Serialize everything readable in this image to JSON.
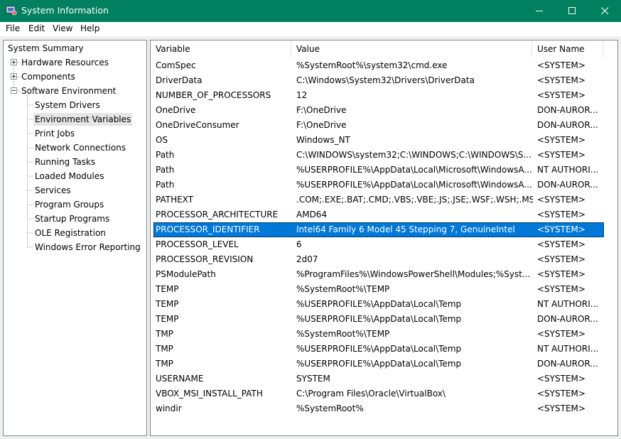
{
  "window": {
    "title": "System Information",
    "icon": "system-information-icon",
    "titlebar_color": "#00805f",
    "controls": [
      "minimize-icon",
      "maximize-icon",
      "close-icon"
    ]
  },
  "menu": [
    "File",
    "Edit",
    "View",
    "Help"
  ],
  "tree": [
    {
      "label": "System Summary",
      "level": 0,
      "expander": "none"
    },
    {
      "label": "Hardware Resources",
      "level": 1,
      "expander": "plus"
    },
    {
      "label": "Components",
      "level": 1,
      "expander": "plus"
    },
    {
      "label": "Software Environment",
      "level": 1,
      "expander": "minus"
    },
    {
      "label": "System Drivers",
      "level": 2
    },
    {
      "label": "Environment Variables",
      "level": 2,
      "selected": true
    },
    {
      "label": "Print Jobs",
      "level": 2
    },
    {
      "label": "Network Connections",
      "level": 2
    },
    {
      "label": "Running Tasks",
      "level": 2
    },
    {
      "label": "Loaded Modules",
      "level": 2
    },
    {
      "label": "Services",
      "level": 2
    },
    {
      "label": "Program Groups",
      "level": 2
    },
    {
      "label": "Startup Programs",
      "level": 2
    },
    {
      "label": "OLE Registration",
      "level": 2
    },
    {
      "label": "Windows Error Reporting",
      "level": 2
    }
  ],
  "table": {
    "columns": [
      "Variable",
      "Value",
      "User Name"
    ],
    "selection_color": "#0078d7",
    "rows": [
      [
        "ComSpec",
        "%SystemRoot%\\system32\\cmd.exe",
        "<SYSTEM>"
      ],
      [
        "DriverData",
        "C:\\Windows\\System32\\Drivers\\DriverData",
        "<SYSTEM>"
      ],
      [
        "NUMBER_OF_PROCESSORS",
        "12",
        "<SYSTEM>"
      ],
      [
        "OneDrive",
        "F:\\OneDrive",
        "DON-AUROR..."
      ],
      [
        "OneDriveConsumer",
        "F:\\OneDrive",
        "DON-AUROR..."
      ],
      [
        "OS",
        "Windows_NT",
        "<SYSTEM>"
      ],
      [
        "Path",
        "C:\\WINDOWS\\system32;C:\\WINDOWS;C:\\WINDOWS\\S...",
        "<SYSTEM>"
      ],
      [
        "Path",
        "%USERPROFILE%\\AppData\\Local\\Microsoft\\WindowsA...",
        "NT AUTHORI..."
      ],
      [
        "Path",
        "%USERPROFILE%\\AppData\\Local\\Microsoft\\WindowsA...",
        "DON-AUROR..."
      ],
      [
        "PATHEXT",
        ".COM;.EXE;.BAT;.CMD;.VBS;.VBE;.JS;.JSE;.WSF;.WSH;.MSC",
        "<SYSTEM>"
      ],
      [
        "PROCESSOR_ARCHITECTURE",
        "AMD64",
        "<SYSTEM>"
      ],
      [
        "PROCESSOR_IDENTIFIER",
        "Intel64 Family 6 Model 45 Stepping 7, GenuineIntel",
        "<SYSTEM>"
      ],
      [
        "PROCESSOR_LEVEL",
        "6",
        "<SYSTEM>"
      ],
      [
        "PROCESSOR_REVISION",
        "2d07",
        "<SYSTEM>"
      ],
      [
        "PSModulePath",
        "%ProgramFiles%\\WindowsPowerShell\\Modules;%Syst...",
        "<SYSTEM>"
      ],
      [
        "TEMP",
        "%SystemRoot%\\TEMP",
        "<SYSTEM>"
      ],
      [
        "TEMP",
        "%USERPROFILE%\\AppData\\Local\\Temp",
        "NT AUTHORI..."
      ],
      [
        "TEMP",
        "%USERPROFILE%\\AppData\\Local\\Temp",
        "DON-AUROR..."
      ],
      [
        "TMP",
        "%SystemRoot%\\TEMP",
        "<SYSTEM>"
      ],
      [
        "TMP",
        "%USERPROFILE%\\AppData\\Local\\Temp",
        "NT AUTHORI..."
      ],
      [
        "TMP",
        "%USERPROFILE%\\AppData\\Local\\Temp",
        "DON-AUROR..."
      ],
      [
        "USERNAME",
        "SYSTEM",
        "<SYSTEM>"
      ],
      [
        "VBOX_MSI_INSTALL_PATH",
        "C:\\Program Files\\Oracle\\VirtualBox\\",
        "<SYSTEM>"
      ],
      [
        "windir",
        "%SystemRoot%",
        "<SYSTEM>"
      ]
    ],
    "selected_row": 11
  }
}
